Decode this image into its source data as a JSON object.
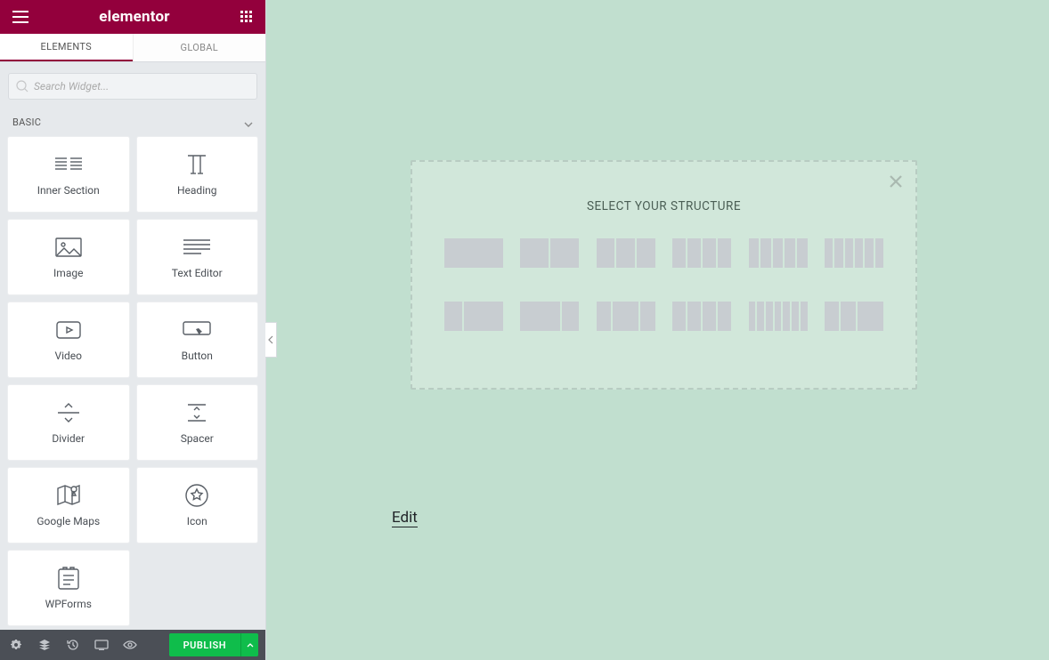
{
  "brand": "elementor",
  "tabs": {
    "elements": "ELEMENTS",
    "global": "GLOBAL"
  },
  "search": {
    "placeholder": "Search Widget..."
  },
  "category": {
    "basic": "BASIC"
  },
  "widgets": {
    "inner_section": "Inner Section",
    "heading": "Heading",
    "image": "Image",
    "text_editor": "Text Editor",
    "video": "Video",
    "button": "Button",
    "divider": "Divider",
    "spacer": "Spacer",
    "google_maps": "Google Maps",
    "icon": "Icon",
    "wpforms": "WPForms"
  },
  "footer": {
    "publish": "PUBLISH"
  },
  "structure": {
    "title": "SELECT YOUR STRUCTURE"
  },
  "canvas": {
    "edit": "Edit"
  }
}
